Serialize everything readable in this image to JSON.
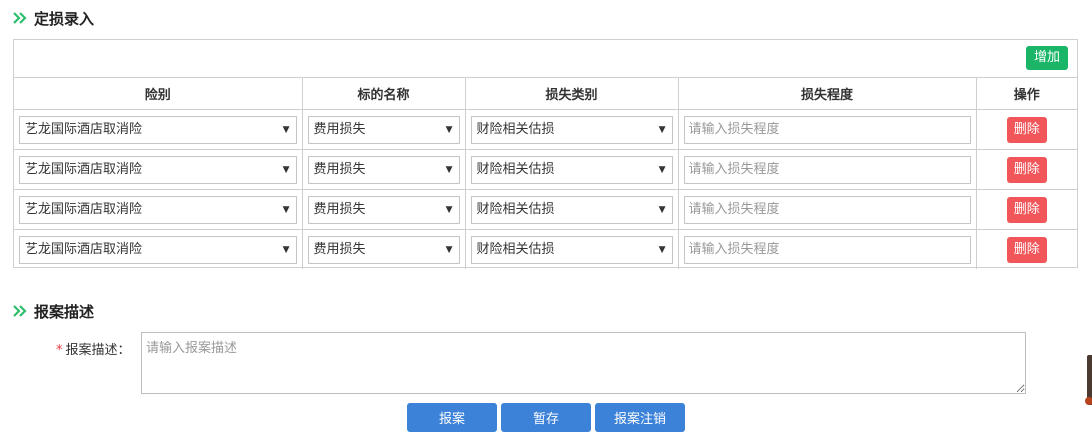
{
  "loss_section": {
    "title": "定损录入",
    "add_label": "增加",
    "columns": [
      "险别",
      "标的名称",
      "损失类别",
      "损失程度",
      "操作"
    ],
    "rows": [
      {
        "insurance_type": "艺龙国际酒店取消险",
        "subject_name": "费用损失",
        "loss_category": "财险相关估损",
        "loss_degree_placeholder": "请输入损失程度",
        "delete_label": "删除"
      },
      {
        "insurance_type": "艺龙国际酒店取消险",
        "subject_name": "费用损失",
        "loss_category": "财险相关估损",
        "loss_degree_placeholder": "请输入损失程度",
        "delete_label": "删除"
      },
      {
        "insurance_type": "艺龙国际酒店取消险",
        "subject_name": "费用损失",
        "loss_category": "财险相关估损",
        "loss_degree_placeholder": "请输入损失程度",
        "delete_label": "删除"
      },
      {
        "insurance_type": "艺龙国际酒店取消险",
        "subject_name": "费用损失",
        "loss_category": "财险相关估损",
        "loss_degree_placeholder": "请输入损失程度",
        "delete_label": "删除"
      }
    ]
  },
  "report_section": {
    "title": "报案描述",
    "required_mark": "*",
    "field_label": "报案描述：",
    "placeholder": "请输入报案描述"
  },
  "actions": {
    "report_label": "报案",
    "save_draft_label": "暂存",
    "cancel_report_label": "报案注销"
  },
  "colors": {
    "accent_green": "#1bb567",
    "danger_red": "#f0565a",
    "primary_blue": "#3d82d9",
    "chevron_green": "#2dbe6c"
  }
}
